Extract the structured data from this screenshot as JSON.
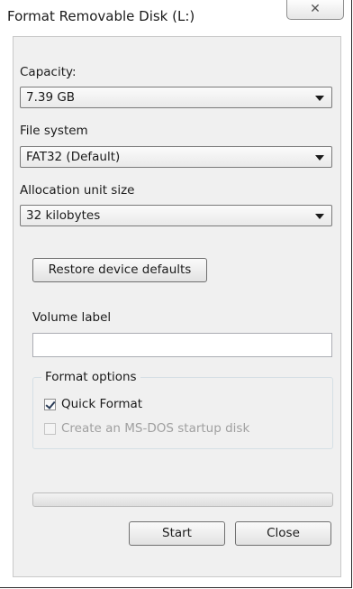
{
  "window": {
    "title": "Format Removable Disk (L:)"
  },
  "capacity": {
    "label": "Capacity:",
    "value": "7.39 GB"
  },
  "file_system": {
    "label": "File system",
    "value": "FAT32 (Default)"
  },
  "allocation": {
    "label": "Allocation unit size",
    "value": "32 kilobytes"
  },
  "restore_button": "Restore device defaults",
  "volume": {
    "label": "Volume label",
    "value": ""
  },
  "format_options": {
    "title": "Format options",
    "quick_format": {
      "label": "Quick Format",
      "checked": true,
      "enabled": true
    },
    "msdos": {
      "label": "Create an MS-DOS startup disk",
      "checked": false,
      "enabled": false
    }
  },
  "progress": {
    "fraction": 0
  },
  "buttons": {
    "start": "Start",
    "close": "Close"
  },
  "icons": {
    "close": "close-icon",
    "dropdown": "chevron-down-icon"
  }
}
